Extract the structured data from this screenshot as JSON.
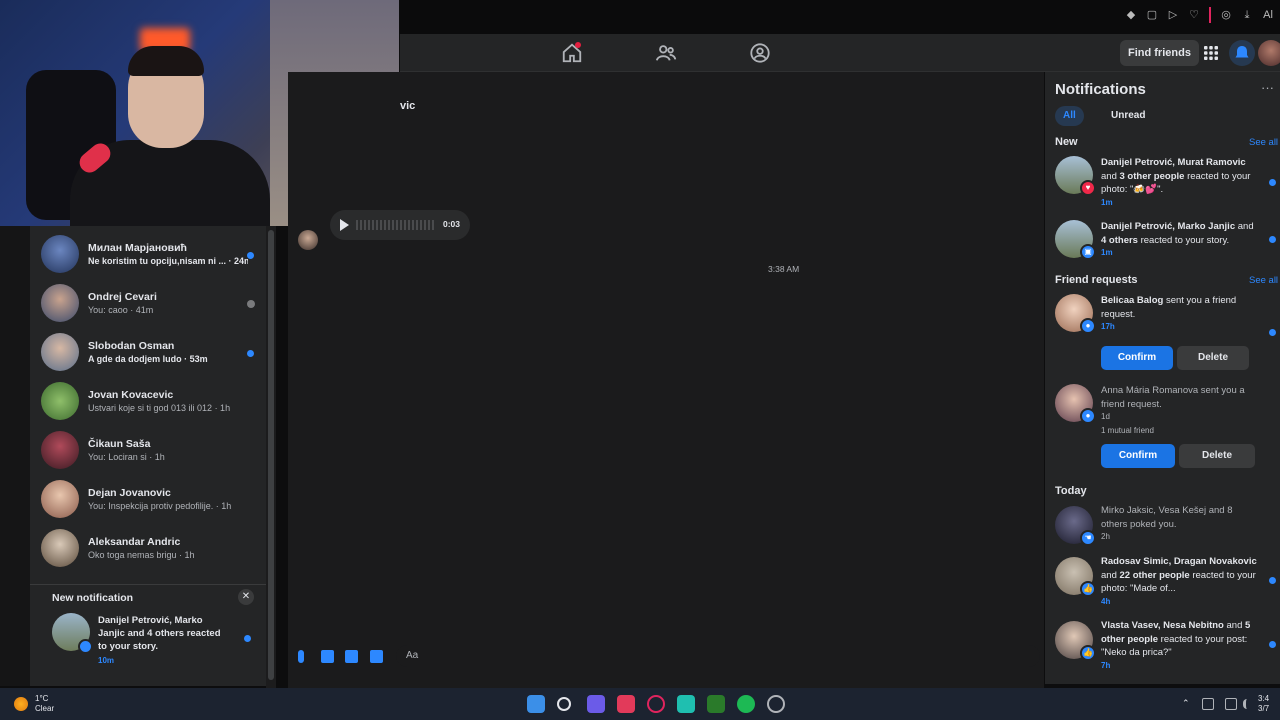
{
  "browser": {
    "extension_label": "Al"
  },
  "topbar": {
    "find_friends": "Find friends"
  },
  "conversation": {
    "name_fragment": "vic",
    "voice_duration": "0:03",
    "timestamp": "3:38 AM",
    "composer_placeholder": "Aa"
  },
  "chat_list": [
    {
      "name": "Милан Марјановић",
      "preview": "Ne koristim tu opciju,nisam ni ... · 24m",
      "unread": true
    },
    {
      "name": "Ondrej Cevari",
      "preview": "You: caoo · 41m",
      "unread": false
    },
    {
      "name": "Slobodan Osman",
      "preview": "A gde da dodjem ludo · 53m",
      "unread": true
    },
    {
      "name": "Jovan Kovacevic",
      "preview": "Ustvari koje si ti god 013 ili 012 · 1h",
      "unread": false
    },
    {
      "name": "Čikaun Saša",
      "preview": "You: Lociran si · 1h",
      "unread": false
    },
    {
      "name": "Dejan Jovanovic",
      "preview": "You: Inspekcija protiv pedofilije. · 1h",
      "unread": false
    },
    {
      "name": "Aleksandar Andric",
      "preview": "Oko toga nemas brigu · 1h",
      "unread": false
    }
  ],
  "new_notification": {
    "title": "New notification",
    "text": "Danijel Petrović, Marko Janjic and 4 others reacted to your story.",
    "time": "10m"
  },
  "notifications": {
    "title": "Notifications",
    "more": "···",
    "tabs": [
      "All",
      "Unread"
    ],
    "section_new": "New",
    "section_friend_requests": "Friend requests",
    "section_today": "Today",
    "see_all": "See all",
    "new_items": [
      {
        "actors": "Danijel Petrović, Murat Ramovic",
        "rest": " and ",
        "others": "3 other people",
        "tail": " reacted to your photo: \"🍻💕\".",
        "time": "1m"
      },
      {
        "actors": "Danijel Petrović, Marko Janjic",
        "rest": " and ",
        "others": "4 others",
        "tail": " reacted to your story.",
        "time": "1m"
      }
    ],
    "friend_requests": [
      {
        "name": "Belicaa Balog",
        "text": " sent you a friend request.",
        "time": "17h",
        "mutual": "",
        "confirm": "Confirm",
        "delete": "Delete"
      },
      {
        "name": "Anna Mária Romanova",
        "text": " sent you a friend request.",
        "time": "1d",
        "mutual": "1 mutual friend",
        "confirm": "Confirm",
        "delete": "Delete"
      }
    ],
    "today_items": [
      {
        "actors": "Mirko Jaksic, Vesa Kešej",
        "rest": " and ",
        "others": "8 others",
        "tail": " poked you.",
        "time": "2h"
      },
      {
        "actors": "Radosav Simic, Dragan Novakovic",
        "rest": " and ",
        "others": "22 other people",
        "tail": " reacted to your photo: \"Made of...",
        "time": "4h"
      },
      {
        "actors": "Vlasta Vasev, Nesa Nebitno",
        "rest": " and ",
        "others": "5 other people",
        "tail": " reacted to your post: \"Neko da prica?\"",
        "time": "7h"
      }
    ]
  },
  "taskbar": {
    "temp": "1°C",
    "condition": "Clear",
    "time": "3:4",
    "date": "3/7"
  },
  "colors": {
    "accent": "#2d88ff",
    "panel": "#242526",
    "confirm": "#1b74e4"
  }
}
